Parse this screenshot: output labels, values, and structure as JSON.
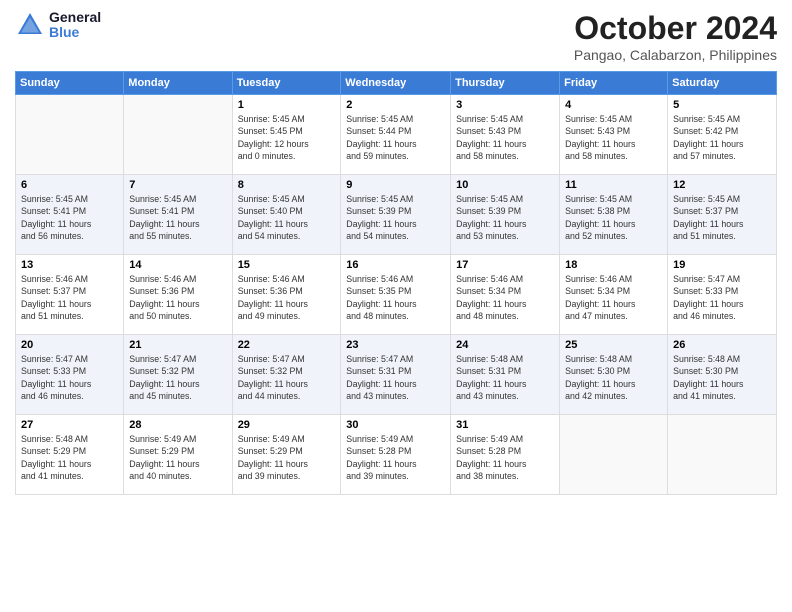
{
  "header": {
    "logo_line1": "General",
    "logo_line2": "Blue",
    "title": "October 2024",
    "location": "Pangao, Calabarzon, Philippines"
  },
  "days_of_week": [
    "Sunday",
    "Monday",
    "Tuesday",
    "Wednesday",
    "Thursday",
    "Friday",
    "Saturday"
  ],
  "weeks": [
    [
      {
        "day": "",
        "info": ""
      },
      {
        "day": "",
        "info": ""
      },
      {
        "day": "1",
        "info": "Sunrise: 5:45 AM\nSunset: 5:45 PM\nDaylight: 12 hours\nand 0 minutes."
      },
      {
        "day": "2",
        "info": "Sunrise: 5:45 AM\nSunset: 5:44 PM\nDaylight: 11 hours\nand 59 minutes."
      },
      {
        "day": "3",
        "info": "Sunrise: 5:45 AM\nSunset: 5:43 PM\nDaylight: 11 hours\nand 58 minutes."
      },
      {
        "day": "4",
        "info": "Sunrise: 5:45 AM\nSunset: 5:43 PM\nDaylight: 11 hours\nand 58 minutes."
      },
      {
        "day": "5",
        "info": "Sunrise: 5:45 AM\nSunset: 5:42 PM\nDaylight: 11 hours\nand 57 minutes."
      }
    ],
    [
      {
        "day": "6",
        "info": "Sunrise: 5:45 AM\nSunset: 5:41 PM\nDaylight: 11 hours\nand 56 minutes."
      },
      {
        "day": "7",
        "info": "Sunrise: 5:45 AM\nSunset: 5:41 PM\nDaylight: 11 hours\nand 55 minutes."
      },
      {
        "day": "8",
        "info": "Sunrise: 5:45 AM\nSunset: 5:40 PM\nDaylight: 11 hours\nand 54 minutes."
      },
      {
        "day": "9",
        "info": "Sunrise: 5:45 AM\nSunset: 5:39 PM\nDaylight: 11 hours\nand 54 minutes."
      },
      {
        "day": "10",
        "info": "Sunrise: 5:45 AM\nSunset: 5:39 PM\nDaylight: 11 hours\nand 53 minutes."
      },
      {
        "day": "11",
        "info": "Sunrise: 5:45 AM\nSunset: 5:38 PM\nDaylight: 11 hours\nand 52 minutes."
      },
      {
        "day": "12",
        "info": "Sunrise: 5:45 AM\nSunset: 5:37 PM\nDaylight: 11 hours\nand 51 minutes."
      }
    ],
    [
      {
        "day": "13",
        "info": "Sunrise: 5:46 AM\nSunset: 5:37 PM\nDaylight: 11 hours\nand 51 minutes."
      },
      {
        "day": "14",
        "info": "Sunrise: 5:46 AM\nSunset: 5:36 PM\nDaylight: 11 hours\nand 50 minutes."
      },
      {
        "day": "15",
        "info": "Sunrise: 5:46 AM\nSunset: 5:36 PM\nDaylight: 11 hours\nand 49 minutes."
      },
      {
        "day": "16",
        "info": "Sunrise: 5:46 AM\nSunset: 5:35 PM\nDaylight: 11 hours\nand 48 minutes."
      },
      {
        "day": "17",
        "info": "Sunrise: 5:46 AM\nSunset: 5:34 PM\nDaylight: 11 hours\nand 48 minutes."
      },
      {
        "day": "18",
        "info": "Sunrise: 5:46 AM\nSunset: 5:34 PM\nDaylight: 11 hours\nand 47 minutes."
      },
      {
        "day": "19",
        "info": "Sunrise: 5:47 AM\nSunset: 5:33 PM\nDaylight: 11 hours\nand 46 minutes."
      }
    ],
    [
      {
        "day": "20",
        "info": "Sunrise: 5:47 AM\nSunset: 5:33 PM\nDaylight: 11 hours\nand 46 minutes."
      },
      {
        "day": "21",
        "info": "Sunrise: 5:47 AM\nSunset: 5:32 PM\nDaylight: 11 hours\nand 45 minutes."
      },
      {
        "day": "22",
        "info": "Sunrise: 5:47 AM\nSunset: 5:32 PM\nDaylight: 11 hours\nand 44 minutes."
      },
      {
        "day": "23",
        "info": "Sunrise: 5:47 AM\nSunset: 5:31 PM\nDaylight: 11 hours\nand 43 minutes."
      },
      {
        "day": "24",
        "info": "Sunrise: 5:48 AM\nSunset: 5:31 PM\nDaylight: 11 hours\nand 43 minutes."
      },
      {
        "day": "25",
        "info": "Sunrise: 5:48 AM\nSunset: 5:30 PM\nDaylight: 11 hours\nand 42 minutes."
      },
      {
        "day": "26",
        "info": "Sunrise: 5:48 AM\nSunset: 5:30 PM\nDaylight: 11 hours\nand 41 minutes."
      }
    ],
    [
      {
        "day": "27",
        "info": "Sunrise: 5:48 AM\nSunset: 5:29 PM\nDaylight: 11 hours\nand 41 minutes."
      },
      {
        "day": "28",
        "info": "Sunrise: 5:49 AM\nSunset: 5:29 PM\nDaylight: 11 hours\nand 40 minutes."
      },
      {
        "day": "29",
        "info": "Sunrise: 5:49 AM\nSunset: 5:29 PM\nDaylight: 11 hours\nand 39 minutes."
      },
      {
        "day": "30",
        "info": "Sunrise: 5:49 AM\nSunset: 5:28 PM\nDaylight: 11 hours\nand 39 minutes."
      },
      {
        "day": "31",
        "info": "Sunrise: 5:49 AM\nSunset: 5:28 PM\nDaylight: 11 hours\nand 38 minutes."
      },
      {
        "day": "",
        "info": ""
      },
      {
        "day": "",
        "info": ""
      }
    ]
  ]
}
